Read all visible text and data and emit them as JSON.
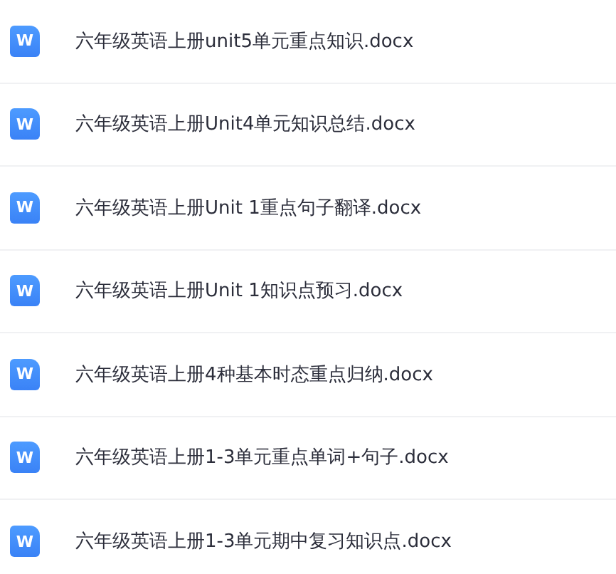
{
  "files": [
    {
      "name": "六年级英语上册unit5单元重点知识.docx",
      "icon_letter": "W"
    },
    {
      "name": "六年级英语上册Unit4单元知识总结.docx",
      "icon_letter": "W"
    },
    {
      "name": "六年级英语上册Unit 1重点句子翻译.docx",
      "icon_letter": "W"
    },
    {
      "name": "六年级英语上册Unit 1知识点预习.docx",
      "icon_letter": "W"
    },
    {
      "name": "六年级英语上册4种基本时态重点归纳.docx",
      "icon_letter": "W"
    },
    {
      "name": "六年级英语上册1-3单元重点单词+句子.docx",
      "icon_letter": "W"
    },
    {
      "name": "六年级英语上册1-3单元期中复习知识点.docx",
      "icon_letter": "W"
    }
  ]
}
